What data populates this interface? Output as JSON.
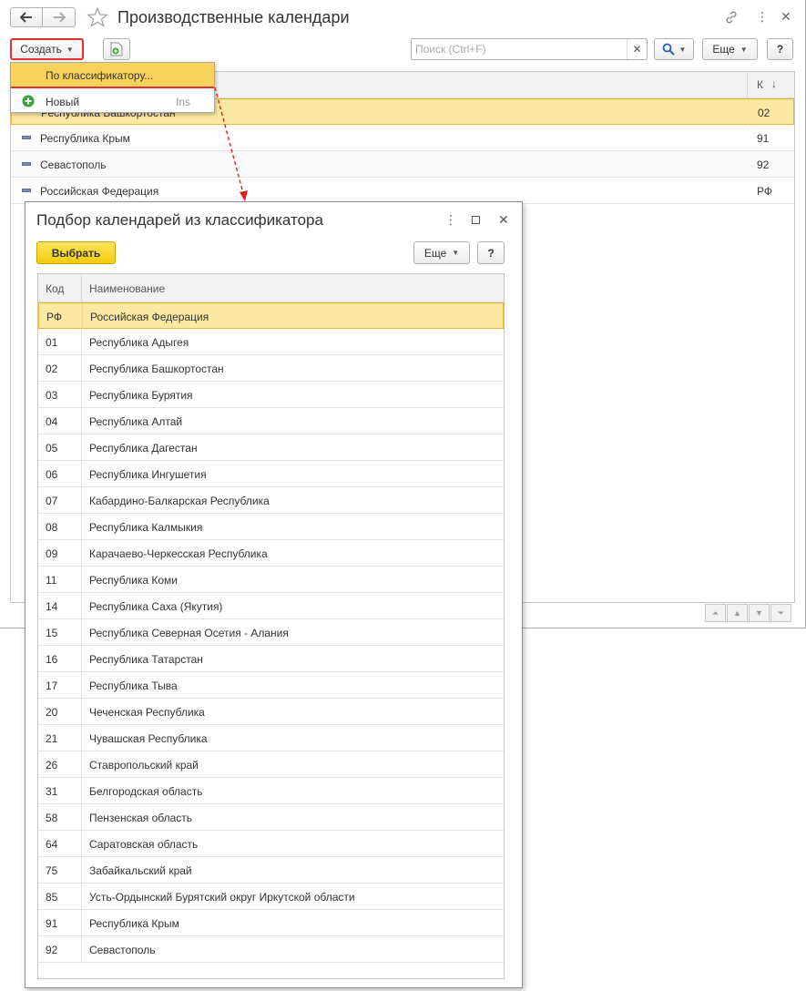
{
  "main": {
    "title": "Производственные календари",
    "create_label": "Создать",
    "search_placeholder": "Поиск (Ctrl+F)",
    "more_label": "Еще",
    "help_label": "?",
    "table": {
      "code_header": "К",
      "rows": [
        {
          "name": "Республика Башкортостан",
          "code": "02"
        },
        {
          "name": "Республика Крым",
          "code": "91"
        },
        {
          "name": "Севастополь",
          "code": "92"
        },
        {
          "name": "Российская Федерация",
          "code": "РФ"
        }
      ]
    }
  },
  "dropdown": {
    "item_classifier": "По классификатору...",
    "item_new": "Новый",
    "item_new_shortcut": "Ins"
  },
  "dialog": {
    "title": "Подбор календарей из классификатора",
    "select_label": "Выбрать",
    "more_label": "Еще",
    "help_label": "?",
    "col_code": "Код",
    "col_name": "Наименование",
    "rows": [
      {
        "code": "РФ",
        "name": "Российская Федерация"
      },
      {
        "code": "01",
        "name": "Республика Адыгея"
      },
      {
        "code": "02",
        "name": "Республика Башкортостан"
      },
      {
        "code": "03",
        "name": "Республика Бурятия"
      },
      {
        "code": "04",
        "name": "Республика Алтай"
      },
      {
        "code": "05",
        "name": "Республика Дагестан"
      },
      {
        "code": "06",
        "name": "Республика Ингушетия"
      },
      {
        "code": "07",
        "name": "Кабардино-Балкарская Республика"
      },
      {
        "code": "08",
        "name": "Республика Калмыкия"
      },
      {
        "code": "09",
        "name": "Карачаево-Черкесская Республика"
      },
      {
        "code": "11",
        "name": "Республика Коми"
      },
      {
        "code": "14",
        "name": "Республика Саха (Якутия)"
      },
      {
        "code": "15",
        "name": "Республика Северная Осетия - Алания"
      },
      {
        "code": "16",
        "name": "Республика Татарстан"
      },
      {
        "code": "17",
        "name": "Республика Тыва"
      },
      {
        "code": "20",
        "name": "Чеченская Республика"
      },
      {
        "code": "21",
        "name": "Чувашская Республика"
      },
      {
        "code": "26",
        "name": "Ставропольский край"
      },
      {
        "code": "31",
        "name": "Белгородская область"
      },
      {
        "code": "58",
        "name": "Пензенская область"
      },
      {
        "code": "64",
        "name": "Саратовская область"
      },
      {
        "code": "75",
        "name": "Забайкальский край"
      },
      {
        "code": "85",
        "name": "Усть-Ордынский Бурятский округ Иркутской области"
      },
      {
        "code": "91",
        "name": "Республика Крым"
      },
      {
        "code": "92",
        "name": "Севастополь"
      }
    ]
  },
  "colors": {
    "selected_row": "#fbe9a3",
    "selected_border": "#e8b53a",
    "primary_button": "#f5d21a",
    "highlight_red": "#e0312e",
    "arrow": "#d9211e"
  }
}
